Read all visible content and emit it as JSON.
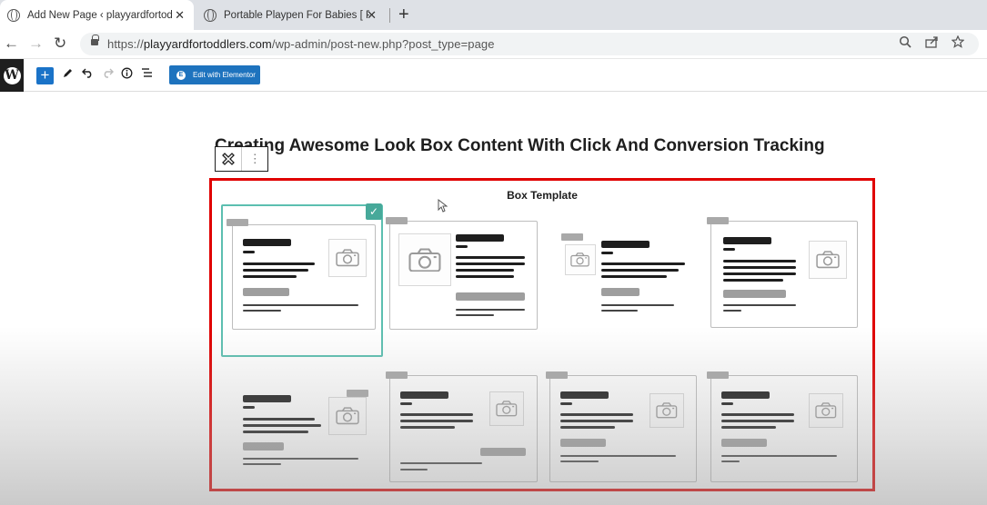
{
  "browser": {
    "tabs": [
      {
        "title": "Add New Page ‹ playyardfortodd",
        "active": true
      },
      {
        "title": "Portable Playpen For Babies [ Pla",
        "active": false
      }
    ],
    "close_glyph": "✕",
    "new_tab_glyph": "+",
    "url_host": "playyardfortoddlers.com",
    "url_prefix": "https://",
    "url_path": "/wp-admin/post-new.php?post_type=page",
    "nav": {
      "back": "←",
      "forward": "→",
      "reload": "↻"
    }
  },
  "editor_toolbar": {
    "wp_logo": "W",
    "inserter": "+",
    "edit_with_elementor": "Edit with Elementor",
    "icons": [
      "pencil-icon",
      "undo-icon",
      "redo-icon",
      "info-icon",
      "list-view-icon"
    ]
  },
  "post": {
    "title": "Creating Awesome Look Box Content With Click And Conversion Tracking"
  },
  "box_block": {
    "heading": "Box Template",
    "selected_template": 1,
    "check_glyph": "✓",
    "more_glyph": "⋮",
    "accent_color": "#47a99a",
    "frame_color": "#e00000"
  }
}
